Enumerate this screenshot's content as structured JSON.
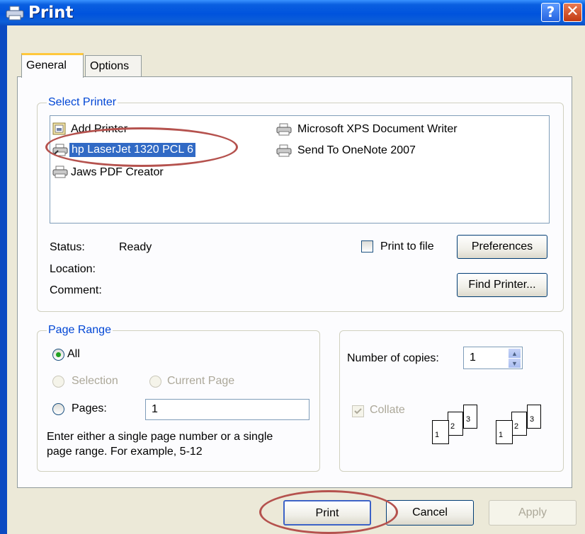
{
  "window": {
    "title": "Print"
  },
  "titlebar": {
    "help_label": "?",
    "close_label": "✕"
  },
  "tabs": [
    {
      "label": "General"
    },
    {
      "label": "Options"
    }
  ],
  "select_printer": {
    "legend": "Select Printer",
    "printers": [
      {
        "label": "Add Printer",
        "icon": "add-printer-icon"
      },
      {
        "label": "hp LaserJet 1320 PCL 6",
        "icon": "printer-icon",
        "selected": true
      },
      {
        "label": "Jaws PDF Creator",
        "icon": "printer-icon"
      },
      {
        "label": "Microsoft XPS Document Writer",
        "icon": "printer-icon"
      },
      {
        "label": "Send To OneNote 2007",
        "icon": "printer-icon"
      }
    ],
    "status_label": "Status:",
    "status_value": "Ready",
    "location_label": "Location:",
    "location_value": "",
    "comment_label": "Comment:",
    "comment_value": "",
    "print_to_file_label": "Print to file",
    "print_to_file_checked": false,
    "preferences_label": "Preferences",
    "find_printer_label": "Find Printer..."
  },
  "page_range": {
    "legend": "Page Range",
    "all_label": "All",
    "selection_label": "Selection",
    "current_page_label": "Current Page",
    "pages_label": "Pages:",
    "pages_value": "1",
    "selected_option": "All",
    "help_line1": "Enter either a single page number or a single",
    "help_line2": "page range.  For example, 5-12"
  },
  "copies": {
    "label": "Number of copies:",
    "value": "1",
    "collate_label": "Collate",
    "collate_checked": true,
    "page_numbers": [
      "1",
      "2",
      "3"
    ]
  },
  "footer": {
    "print_label": "Print",
    "cancel_label": "Cancel",
    "apply_label": "Apply"
  },
  "colors": {
    "title_bar": "#0055e5",
    "dialog_bg": "#ece9d8",
    "annotation": "#b5524e",
    "legend_text": "#0046d5"
  }
}
